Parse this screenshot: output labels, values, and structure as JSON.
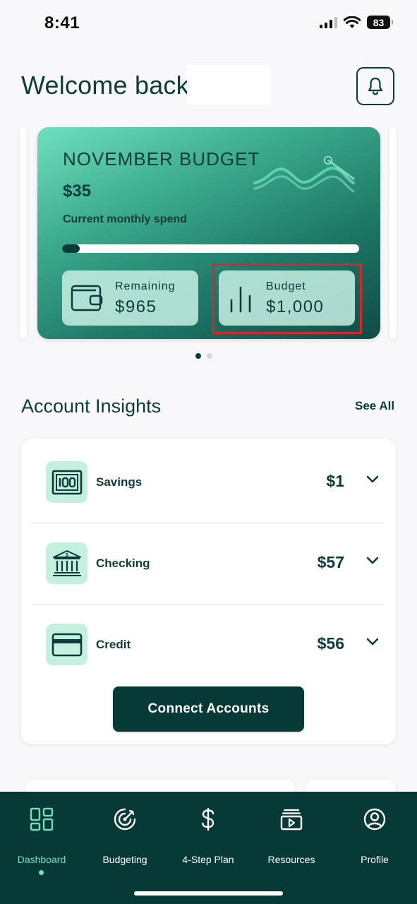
{
  "status_bar": {
    "time": "8:41",
    "battery": "83"
  },
  "header": {
    "welcome": "Welcome back,"
  },
  "budget_card": {
    "title": "NOVEMBER BUDGET",
    "spend": "$35",
    "spend_label": "Current monthly spend",
    "progress_fraction": 0.035,
    "remaining_label": "Remaining",
    "remaining_value": "$965",
    "budget_label": "Budget",
    "budget_value": "$1,000"
  },
  "carousel": {
    "pages": 2,
    "active_page": 1
  },
  "insights": {
    "title": "Account Insights",
    "see_all": "See All",
    "accounts": [
      {
        "name": "Savings",
        "amount": "$1",
        "icon": "money-bill-icon"
      },
      {
        "name": "Checking",
        "amount": "$57",
        "icon": "bank-icon"
      },
      {
        "name": "Credit",
        "amount": "$56",
        "icon": "credit-card-icon"
      }
    ],
    "connect_button": "Connect Accounts"
  },
  "nav": {
    "items": [
      {
        "label": "Dashboard",
        "icon": "dashboard-grid-icon",
        "active": true
      },
      {
        "label": "Budgeting",
        "icon": "budgeting-target-icon",
        "active": false
      },
      {
        "label": "4-Step Plan",
        "icon": "dollar-icon",
        "active": false
      },
      {
        "label": "Resources",
        "icon": "resources-video-icon",
        "active": false
      },
      {
        "label": "Profile",
        "icon": "profile-user-icon",
        "active": false
      }
    ]
  },
  "colors": {
    "brand_dark": "#073936",
    "accent_mint": "#6fe0bf",
    "text_dark": "#0d3b3a",
    "highlight_red": "#d9262c"
  }
}
